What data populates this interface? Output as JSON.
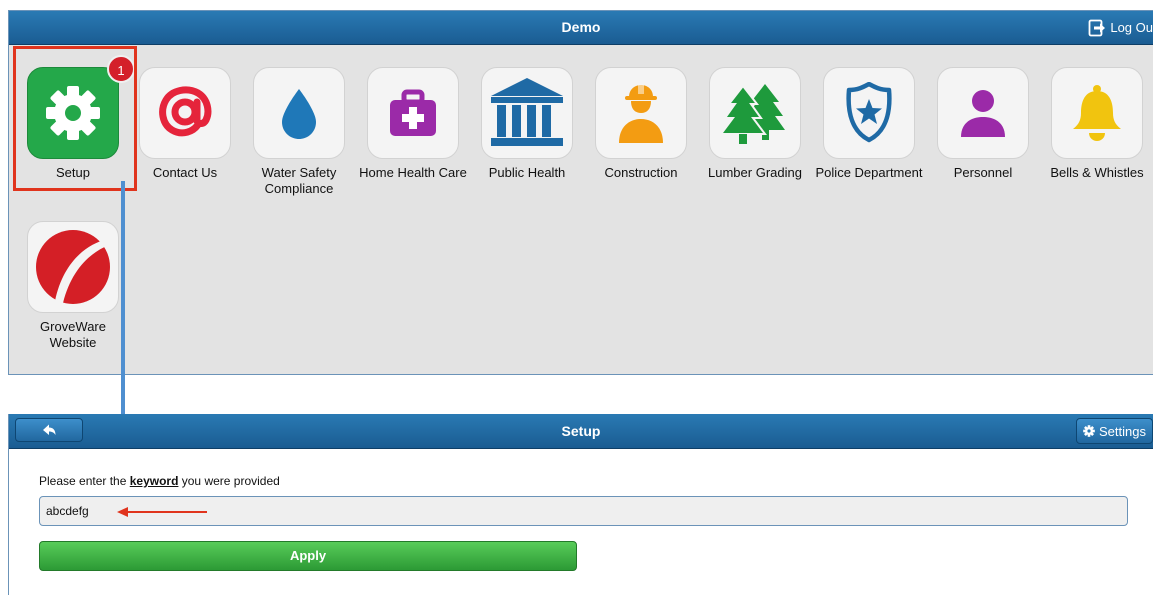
{
  "app": {
    "title": "Demo",
    "logout_label": "Log Ou"
  },
  "colors": {
    "bar": "#1f6aa5",
    "highlight": "#e0341d",
    "badge": "#d4202a",
    "setup_icon_bg": "#24a84a",
    "apply_button": "#3aad3f",
    "connector": "#4f8fd0"
  },
  "tiles": [
    {
      "label": "Setup",
      "icon": "gear-icon",
      "badge": "1"
    },
    {
      "label": "Contact Us",
      "icon": "at-sign-icon"
    },
    {
      "label": "Water Safety Compliance",
      "icon": "water-drop-icon"
    },
    {
      "label": "Home Health Care",
      "icon": "medical-bag-icon"
    },
    {
      "label": "Public Health",
      "icon": "building-columns-icon"
    },
    {
      "label": "Construction",
      "icon": "construction-worker-icon"
    },
    {
      "label": "Lumber Grading",
      "icon": "trees-icon"
    },
    {
      "label": "Police Department",
      "icon": "police-badge-icon"
    },
    {
      "label": "Personnel",
      "icon": "person-icon"
    },
    {
      "label": "Bells & Whistles",
      "icon": "bell-icon"
    },
    {
      "label": "GroveWare Website",
      "icon": "groveware-logo-icon"
    }
  ],
  "setup": {
    "title": "Setup",
    "settings_label": "Settings",
    "prompt_before": "Please enter the ",
    "prompt_keyword": "keyword",
    "prompt_after": " you were provided",
    "keyword_value": "abcdefg",
    "apply_label": "Apply"
  }
}
